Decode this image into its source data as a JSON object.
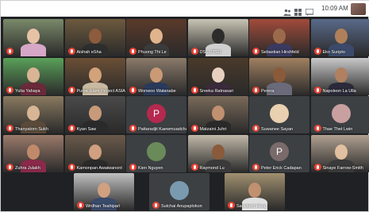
{
  "status_bar": {
    "time": "10:09 AM"
  },
  "tiles": [
    {
      "name": "",
      "bg": "#7a8a6a",
      "head": "#e6c2a6",
      "shirt": "#d6a7c6"
    },
    {
      "name": "Aishah eSha",
      "bg": "#6d5a3e",
      "head": "#8d5b3e",
      "shirt": "#2d2d2d"
    },
    {
      "name": "Phuong Thi Le",
      "bg": "#5b3a2a",
      "head": "#e0b48c",
      "shirt": "#3b3b3b"
    },
    {
      "name": "DSL UTSO",
      "bg": "#c9c4b4",
      "head": "#2c2c2c",
      "shirt": "#d0d0d0"
    },
    {
      "name": "Sebastian Hirshfeld",
      "bg": "#a14b3a",
      "head": "#9a6a4a",
      "shirt": "#3a3a60"
    },
    {
      "name": "Eko Suripto",
      "bg": "#5a6a8a",
      "head": "#b0805a",
      "shirt": "#3b4a6a"
    },
    {
      "name": "Yulia Yahaya",
      "bg": "#5aa05a",
      "head": "#d9b595",
      "shirt": "#6a2a3a"
    },
    {
      "name": "Purse Islam Project ASIA PK",
      "bg": "#6b4f35",
      "head": "#d2a27a",
      "shirt": "#c8b9a0"
    },
    {
      "name": "Wonwoo Watanabe",
      "bg": "#8a7a6a",
      "head": "#c99a75",
      "shirt": "#2a3a5a"
    },
    {
      "name": "Sreeka Ratnasari",
      "bg": "#4a3a2a",
      "head": "#e8d0c0",
      "shirt": "#3a2a3a"
    },
    {
      "name": "Perera",
      "bg": "#a08060",
      "head": "#8a5a3a",
      "shirt": "#6a6a7a"
    },
    {
      "name": "Napoleon La Ulla",
      "bg": "#c8c8c8",
      "head": "#b08060",
      "shirt": "#2a2a3a"
    },
    {
      "name": "Thanyatorn Sukh",
      "bg": "#8a7a60",
      "head": "#d8b595",
      "shirt": "#5a4a3a"
    },
    {
      "name": "Kyan Saw",
      "bg": "#4a4a4a",
      "head": "#c89a7a",
      "shirt": "#2a2a2a"
    },
    {
      "name": "Pattaradjit Kaewmuadchadsa...",
      "avatar": "P",
      "avatar_color": "#b5294e"
    },
    {
      "name": "Matzaini Juhri",
      "bg": "#7a6a5a",
      "head": "#c09070",
      "shirt": "#2a2a2a"
    },
    {
      "name": "Suwanee Sayan",
      "photo_avatar": "#e8d0b0"
    },
    {
      "name": "Thae Thet Lwin",
      "photo_avatar": "#c8a0a0"
    },
    {
      "name": "Zuhra Julakh",
      "bg": "#9a7a6a",
      "head": "#c08a6a",
      "shirt": "#8a2a4a"
    },
    {
      "name": "Kamonpan Awaiwanont",
      "bg": "#6a5a4a",
      "head": "#d0a080",
      "shirt": "#2a2a2a"
    },
    {
      "name": "Kien Nguyen",
      "photo_avatar": "#6a8a5a"
    },
    {
      "name": "Raymond Lu",
      "bg": "#c0b8a8",
      "head": "#8a5a3a",
      "shirt": "#3a3a3a"
    },
    {
      "name": "Peter Erick Cadapan",
      "avatar": "P",
      "avatar_color": "#7a6a6a"
    },
    {
      "name": "Sinaye Farrow-Smith",
      "bg": "#b0a090",
      "head": "#e0c0a0",
      "shirt": "#3a3a3a"
    },
    {
      "name": "Wrdhan Teahiparl",
      "bg": "#c0c0c0",
      "head": "#d0a080",
      "shirt": "#3a4a6a"
    },
    {
      "name": "Sutchai Anupaplokon",
      "photo_avatar": "#7a9ab0"
    },
    {
      "name": "Samdech Heng",
      "bg": "#a09070",
      "head": "#c09070",
      "shirt": "#e0e0e0"
    }
  ]
}
